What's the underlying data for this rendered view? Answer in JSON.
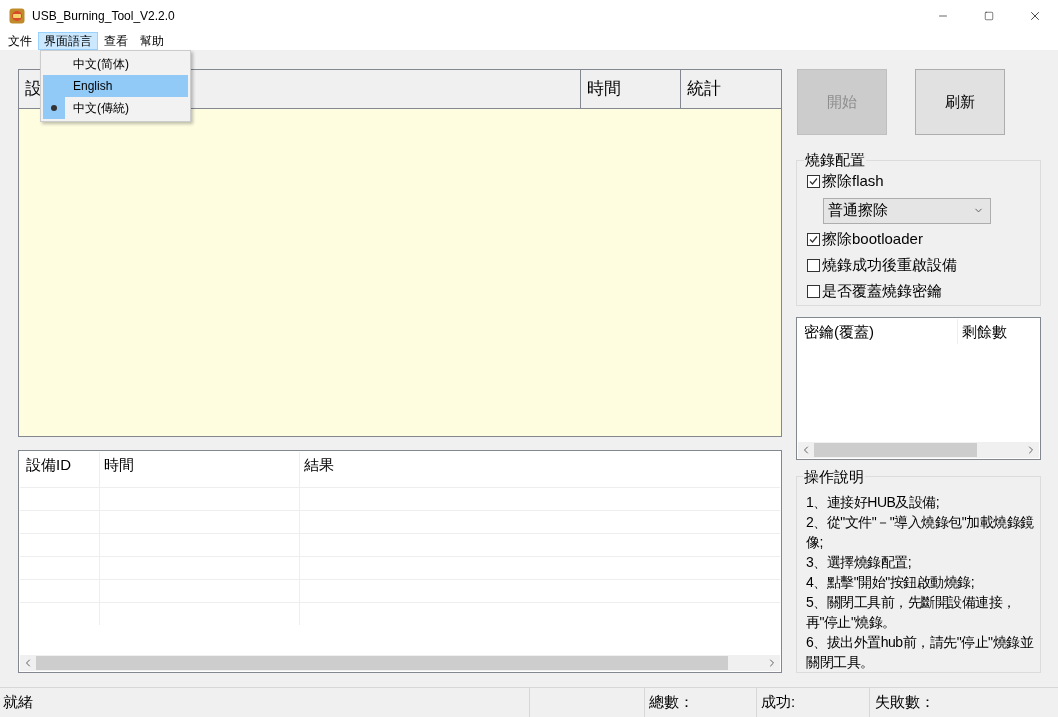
{
  "window": {
    "title": "USB_Burning_Tool_V2.2.0"
  },
  "menu_bar": [
    {
      "label": "文件",
      "open": false
    },
    {
      "label": "界面語言",
      "open": true
    },
    {
      "label": "查看",
      "open": false
    },
    {
      "label": "幫助",
      "open": false
    }
  ],
  "language_menu": [
    {
      "label": "中文(简体)",
      "selected": false,
      "highlighted": false
    },
    {
      "label": "English",
      "selected": false,
      "highlighted": true
    },
    {
      "label": "中文(傳統)",
      "selected": true,
      "highlighted": false
    }
  ],
  "device_table": {
    "columns": [
      "設",
      "時間",
      "統計"
    ]
  },
  "buttons": [
    {
      "label": "開始",
      "disabled": true
    },
    {
      "label": "刷新",
      "disabled": false
    }
  ],
  "burn_config": {
    "title": "燒錄配置",
    "options": [
      {
        "kind": "checkbox",
        "label": "擦除flash",
        "checked": true
      },
      {
        "kind": "select",
        "value": "普通擦除"
      },
      {
        "kind": "checkbox",
        "label": "擦除bootloader",
        "checked": true
      },
      {
        "kind": "checkbox",
        "label": "燒錄成功後重啟設備",
        "checked": false
      },
      {
        "kind": "checkbox",
        "label": "是否覆蓋燒錄密鑰",
        "checked": false
      }
    ]
  },
  "key_table": {
    "columns": [
      "密鑰(覆蓋)",
      "剩餘數"
    ]
  },
  "instructions": {
    "title": "操作說明",
    "items": [
      "1、連接好HUB及設備;",
      "2、從\"文件\"－\"導入燒錄包\"加載燒錄鏡像;",
      "3、選擇燒錄配置;",
      "4、點擊\"開始\"按鈕啟動燒錄;",
      "5、關閉工具前，先斷開設備連接，再\"停止\"燒錄。",
      "6、拔出外置hub前，請先\"停止\"燒錄並關閉工具。"
    ]
  },
  "log_table": {
    "columns": [
      "設備ID",
      "時間",
      "結果"
    ]
  },
  "status_bar": [
    "就緒",
    "總數：",
    "成功:",
    "失敗數："
  ]
}
